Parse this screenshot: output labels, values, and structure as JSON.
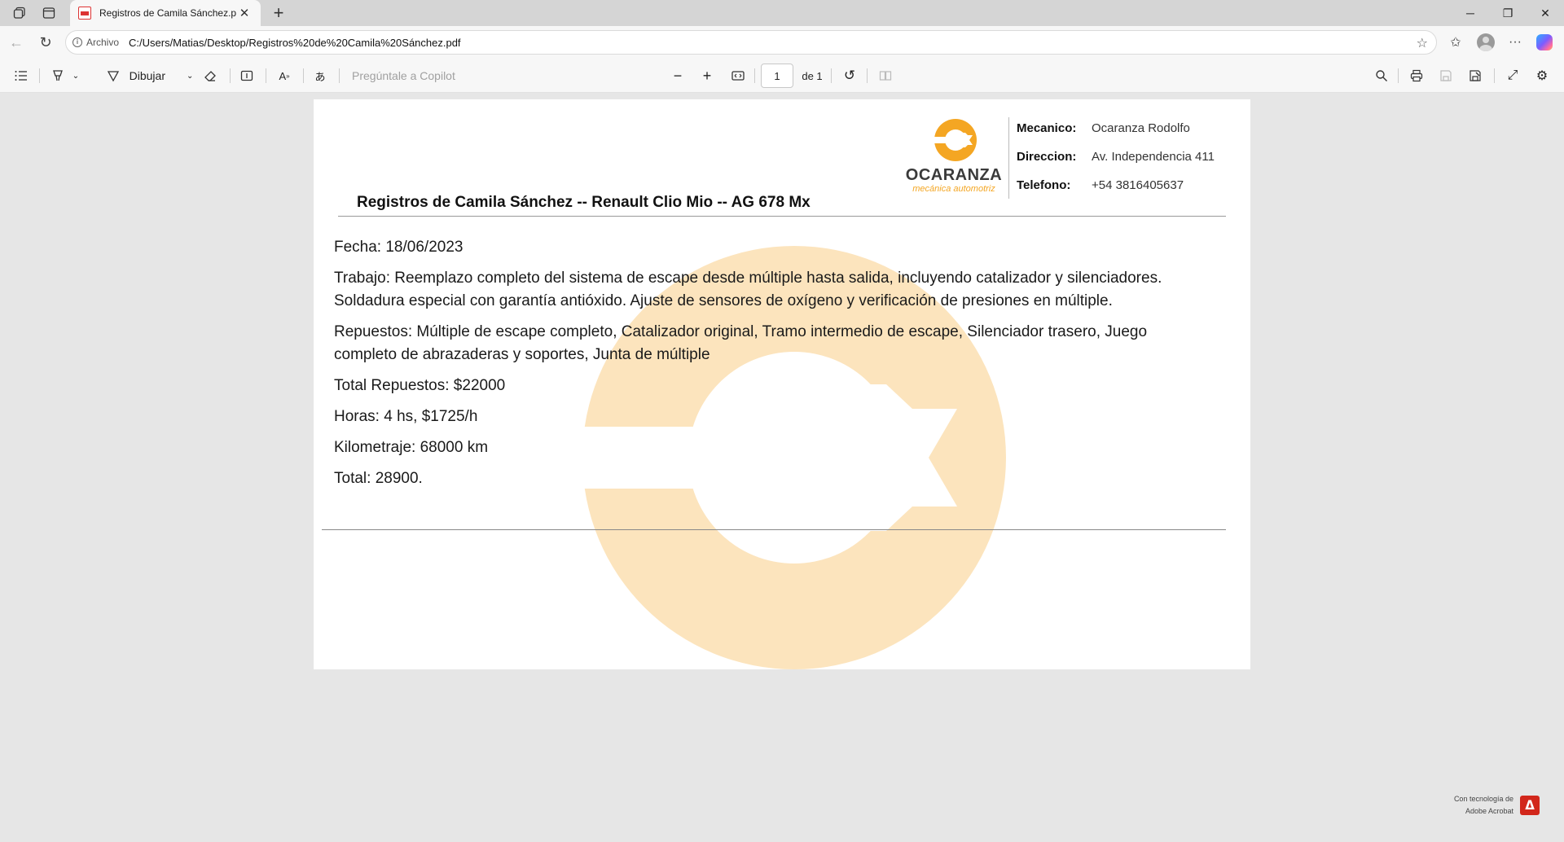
{
  "browser": {
    "tab_title": "Registros de Camila Sánchez.pdf",
    "site_label": "Archivo",
    "url": "C:/Users/Matias/Desktop/Registros%20de%20Camila%20Sánchez.pdf"
  },
  "pdf_toolbar": {
    "draw_label": "Dibujar",
    "copilot_placeholder": "Pregúntale a Copilot",
    "page_number": "1",
    "page_total": "de 1"
  },
  "document": {
    "logo": {
      "name": "OCARANZA",
      "tagline": "mecánica automotriz",
      "color": "#f4a623"
    },
    "info": [
      {
        "label": "Mecanico:",
        "value": "Ocaranza Rodolfo"
      },
      {
        "label": "Direccion:",
        "value": "Av. Independencia 411"
      },
      {
        "label": "Telefono:",
        "value": "+54 3816405637"
      }
    ],
    "title": "Registros de Camila Sánchez -- Renault Clio Mio -- AG 678 Mx",
    "fecha": "Fecha: 18/06/2023",
    "trabajo": "Trabajo: Reemplazo completo del sistema de escape desde múltiple hasta salida, incluyendo catalizador y silenciadores. Soldadura especial con garantía antióxido. Ajuste de sensores de oxígeno y verificación de presiones en múltiple.",
    "repuestos": "Repuestos: Múltiple de escape completo, Catalizador original, Tramo intermedio de escape, Silenciador trasero, Juego completo de abrazaderas y soportes, Junta de múltiple",
    "total_repuestos": "Total Repuestos: $22000",
    "horas": "Horas: 4 hs, $1725/h",
    "kilometraje": "Kilometraje: 68000 km",
    "total": "Total: 28900."
  },
  "footer": {
    "powered_line1": "Con tecnología de",
    "powered_line2": "Adobe Acrobat"
  }
}
